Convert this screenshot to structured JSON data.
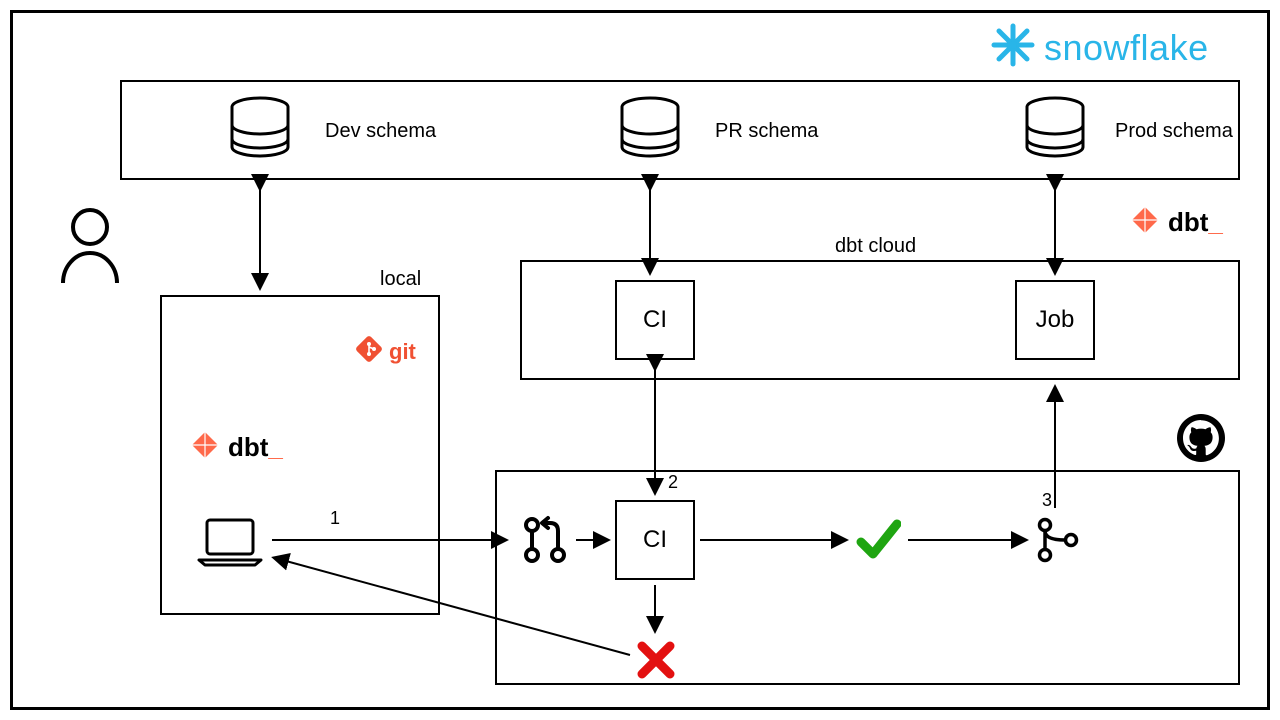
{
  "brand": {
    "snowflake": "snowflake",
    "git": "git",
    "dbt_local": "dbt",
    "dbt_cloud": "dbt"
  },
  "schemas": {
    "dev": "Dev schema",
    "pr": "PR schema",
    "prod": "Prod schema"
  },
  "sections": {
    "local": "local",
    "dbt_cloud": "dbt cloud"
  },
  "nodes": {
    "ci_cloud": "CI",
    "job": "Job",
    "ci_gh": "CI"
  },
  "steps": {
    "s1": "1",
    "s2": "2",
    "s3": "3"
  },
  "colors": {
    "snowflake": "#29B5E8",
    "git": "#F05133",
    "dbt": "#FF694A",
    "check": "#1FA511",
    "cross": "#E31010"
  }
}
